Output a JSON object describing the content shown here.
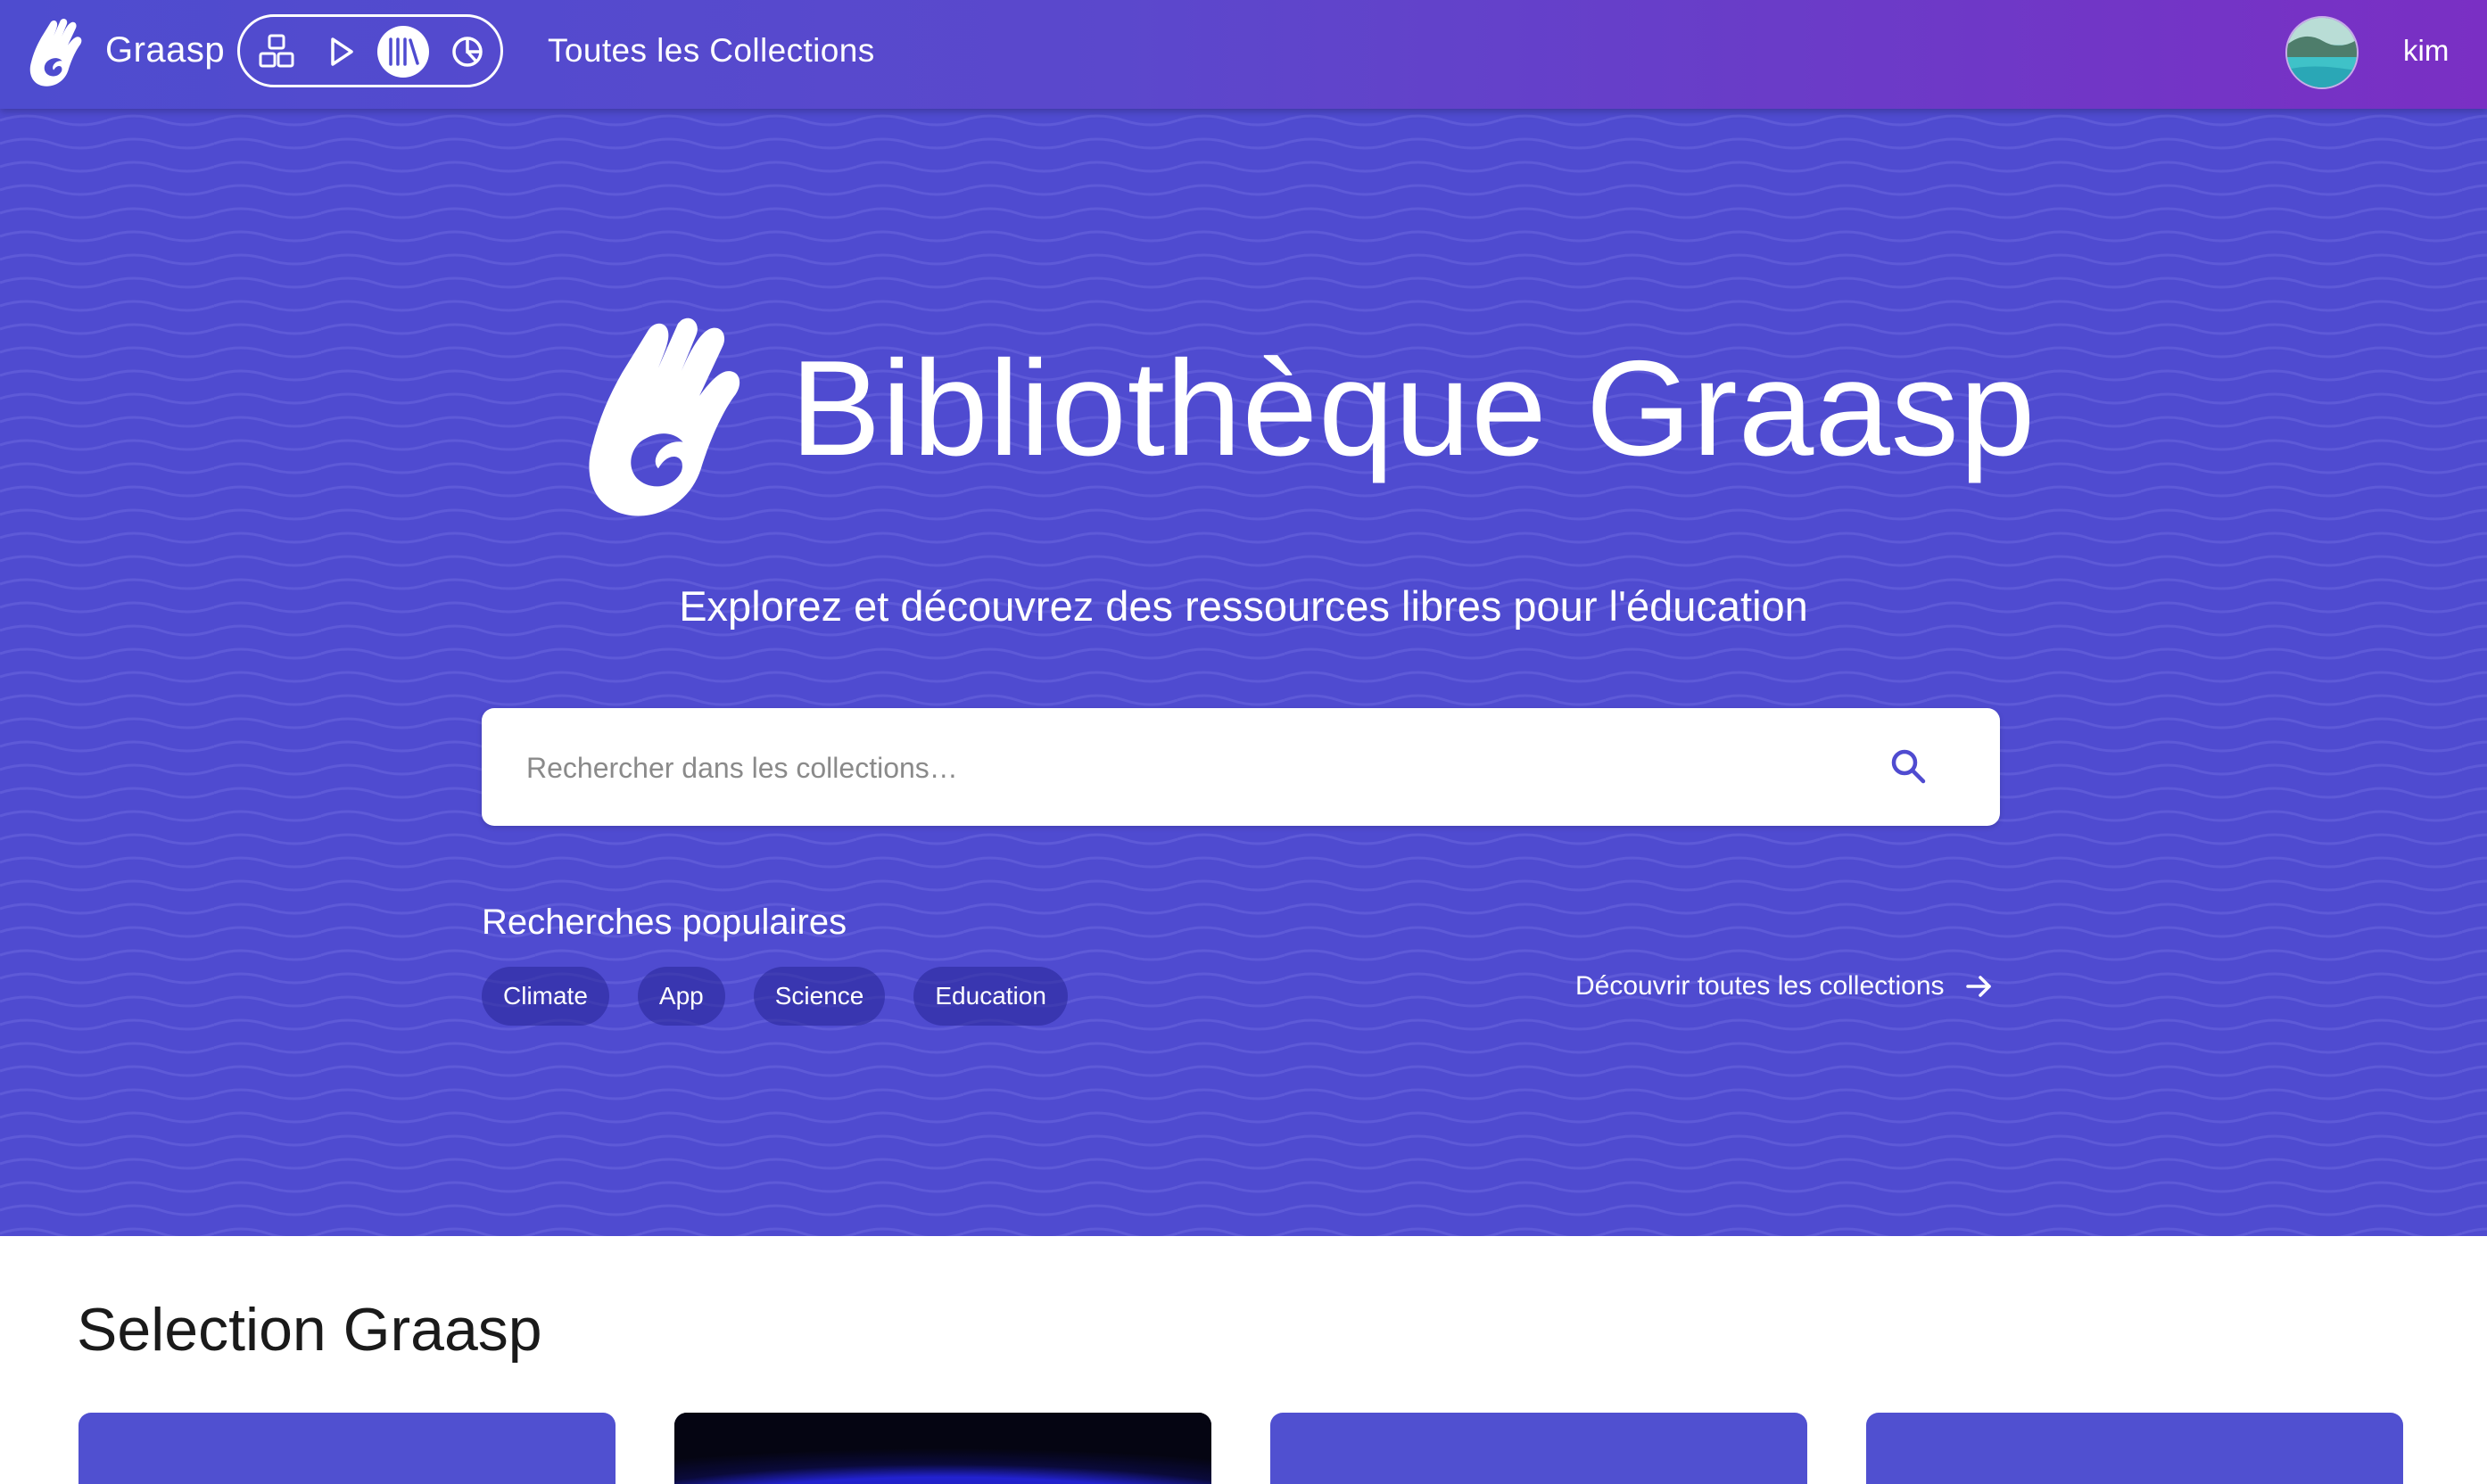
{
  "header": {
    "brand": "Graasp",
    "app_switcher": [
      {
        "name": "builder",
        "icon": "builder-icon",
        "active": false
      },
      {
        "name": "player",
        "icon": "play-icon",
        "active": false
      },
      {
        "name": "library",
        "icon": "library-icon",
        "active": true
      },
      {
        "name": "analytics",
        "icon": "pie-chart-icon",
        "active": false
      }
    ],
    "page_link": "Toutes les Collections",
    "user": {
      "name": "kim",
      "avatar_icon": "avatar-image"
    }
  },
  "hero": {
    "title": "Bibliothèque Graasp",
    "subtitle": "Explorez et découvrez des ressources libres pour l'éducation",
    "search": {
      "placeholder": "Rechercher dans les collections…",
      "value": ""
    },
    "popular_heading": "Recherches populaires",
    "popular_tags": [
      "Climate",
      "App",
      "Science",
      "Education"
    ],
    "discover_link": "Découvrir toutes les collections"
  },
  "selection": {
    "title": "Selection Graasp",
    "cards": [
      {
        "style": "purple"
      },
      {
        "style": "dark"
      },
      {
        "style": "purple"
      },
      {
        "style": "purple"
      }
    ]
  },
  "colors": {
    "primary": "#4f4bd0",
    "header_gradient_end": "#7a2fc4",
    "chip_bg": "#2f2c98"
  }
}
